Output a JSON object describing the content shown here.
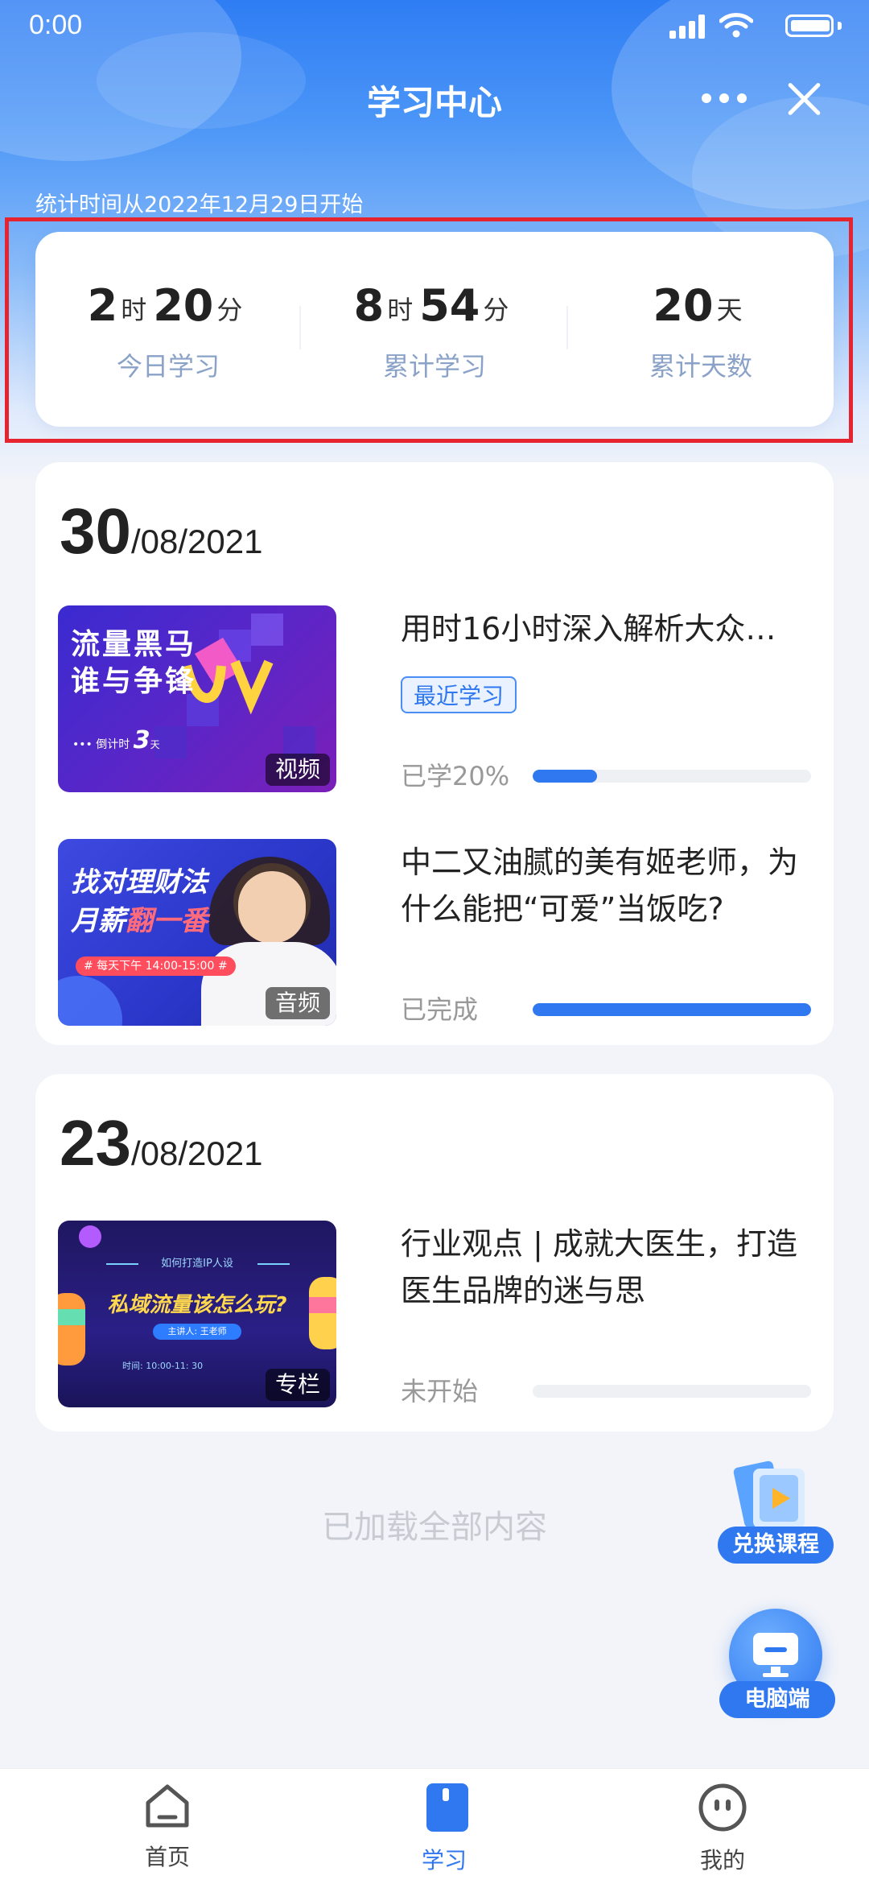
{
  "status_bar": {
    "time": "0:00"
  },
  "header": {
    "title": "学习中心"
  },
  "stats": {
    "since_text": "统计时间从2022年12月29日开始",
    "today": {
      "hours": "2",
      "hour_unit": "时",
      "minutes": "20",
      "minute_unit": "分",
      "label": "今日学习"
    },
    "total": {
      "hours": "8",
      "hour_unit": "时",
      "minutes": "54",
      "minute_unit": "分",
      "label": "累计学习"
    },
    "days": {
      "value": "20",
      "unit": "天",
      "label": "累计天数"
    }
  },
  "groups": [
    {
      "day": "30",
      "rest": "/08/2021",
      "courses": [
        {
          "title": "用时16小时深入解析大众…",
          "badge": "最近学习",
          "progress_text": "已学20%",
          "progress": 0.23,
          "type_tag": "视频",
          "thumb_text": {
            "line1": "流量黑马",
            "line2": "谁与争锋",
            "countdown": "倒计时",
            "countdown_num": "3",
            "countdown_unit": "天"
          }
        },
        {
          "title": "中二又油腻的美有姬老师，为什么能把“可爱”当饭吃?",
          "progress_text": "已完成",
          "progress": 1.0,
          "type_tag": "音频",
          "thumb_text": {
            "line1": "找对理财法",
            "line2a": "月薪",
            "line2b": "翻一番",
            "schedule": "# 每天下午 14:00-15:00 #"
          }
        }
      ]
    },
    {
      "day": "23",
      "rest": "/08/2021",
      "courses": [
        {
          "title": "行业观点 | 成就大医生，打造医生品牌的迷与思",
          "progress_text": "未开始",
          "progress": 0,
          "type_tag": "专栏",
          "thumb_text": {
            "top": "如何打造IP人设",
            "main": "私域流量该怎么玩?",
            "lecturer": "主讲人: 王老师",
            "time": "时间: 10:00-11: 30"
          }
        }
      ]
    }
  ],
  "footer_text": "已加载全部内容",
  "floating": {
    "exchange": "兑换课程",
    "pc": "电脑端"
  },
  "tabbar": {
    "home": "首页",
    "study": "学习",
    "mine": "我的"
  },
  "colors": {
    "accent": "#2f78f0",
    "highlight": "#e5242f"
  }
}
